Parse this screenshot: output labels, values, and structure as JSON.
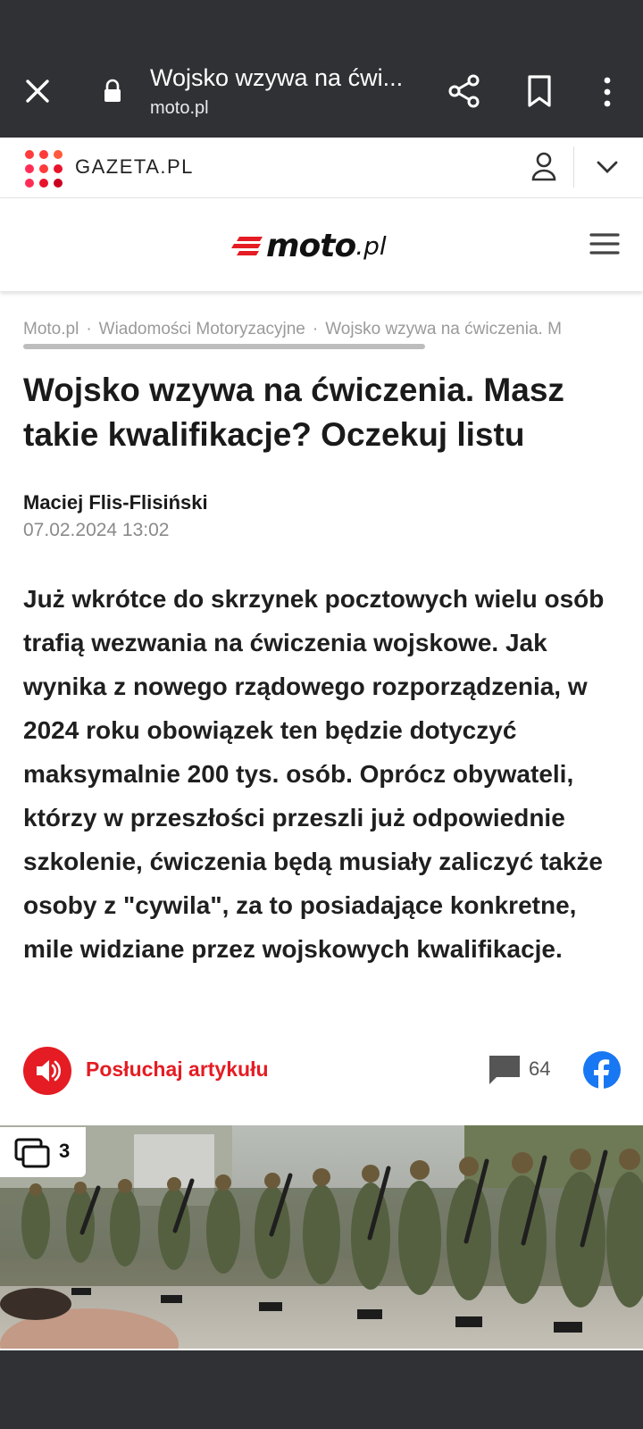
{
  "browser": {
    "tab_title": "Wojsko wzywa na ćwi...",
    "url": "moto.pl"
  },
  "gazeta_bar": {
    "logo_text": "GAZETA.PL"
  },
  "moto_header": {
    "brand_word": "moto",
    "brand_tld": ".pl"
  },
  "breadcrumbs": [
    "Moto.pl",
    "Wiadomości Motoryzacyjne",
    "Wojsko wzywa na ćwiczenia. M"
  ],
  "article": {
    "title": "Wojsko wzywa na ćwiczenia. Masz takie kwalifikacje? Oczekuj listu",
    "author": "Maciej Flis-Flisiński",
    "date": "07.02.2024 13:02",
    "lead": "Już wkrótce do skrzynek pocztowych wielu osób trafią wezwania na ćwiczenia wojskowe. Jak wynika z nowego rządowego rozporządzenia, w 2024 roku obowiązek ten będzie dotyczyć maksymalnie 200 tys. osób. Oprócz obywateli, którzy w przeszłości przeszli już odpowiednie szkolenie, ćwiczenia będą musiały zaliczyć także osoby z \"cywila\", za to posiadające konkretne, mile widziane przez wojskowych kwalifikacje."
  },
  "actions": {
    "listen_label": "Posłuchaj artykułu",
    "comments_count": "64"
  },
  "gallery": {
    "count": "3"
  },
  "colors": {
    "accent_red": "#e51c23",
    "chrome_dark": "#303134",
    "facebook_blue": "#1877f2"
  }
}
